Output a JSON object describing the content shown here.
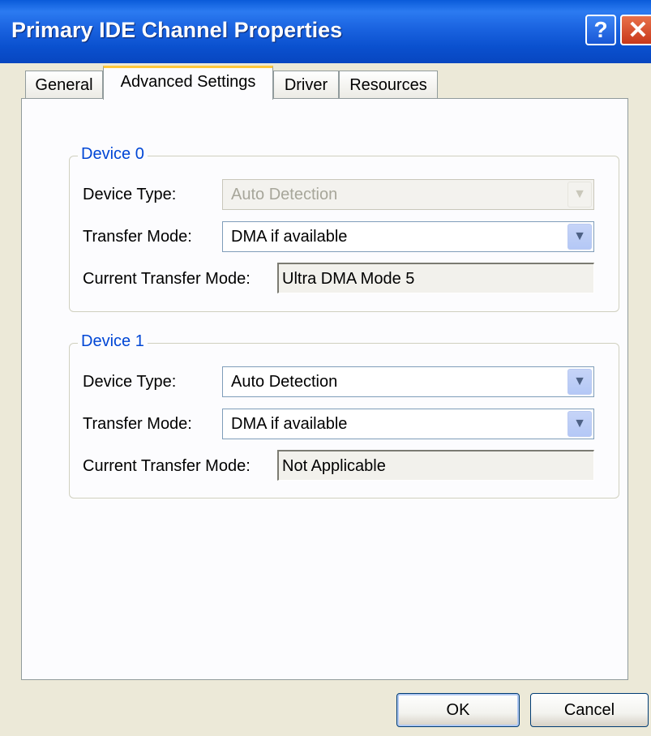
{
  "window": {
    "title": "Primary IDE Channel Properties",
    "help_glyph": "?",
    "close_glyph": "✕"
  },
  "tabs": [
    {
      "label": "General",
      "active": false
    },
    {
      "label": "Advanced Settings",
      "active": true
    },
    {
      "label": "Driver",
      "active": false
    },
    {
      "label": "Resources",
      "active": false
    }
  ],
  "device0": {
    "title": "Device 0",
    "device_type_label": "Device Type:",
    "device_type_value": "Auto Detection",
    "device_type_enabled": false,
    "transfer_mode_label": "Transfer Mode:",
    "transfer_mode_value": "DMA if available",
    "current_mode_label": "Current Transfer Mode:",
    "current_mode_value": "Ultra DMA Mode 5"
  },
  "device1": {
    "title": "Device 1",
    "device_type_label": "Device Type:",
    "device_type_value": "Auto Detection",
    "transfer_mode_label": "Transfer Mode:",
    "transfer_mode_value": "DMA if available",
    "current_mode_label": "Current Transfer Mode:",
    "current_mode_value": "Not Applicable"
  },
  "buttons": {
    "ok": "OK",
    "cancel": "Cancel"
  },
  "colors": {
    "title_bar": "#0A50CE",
    "group_title": "#0046D5",
    "active_tab_accent": "#FFC83C",
    "dialog_bg": "#ECE9D8"
  },
  "icons": {
    "dropdown": "chevron-down-icon"
  }
}
